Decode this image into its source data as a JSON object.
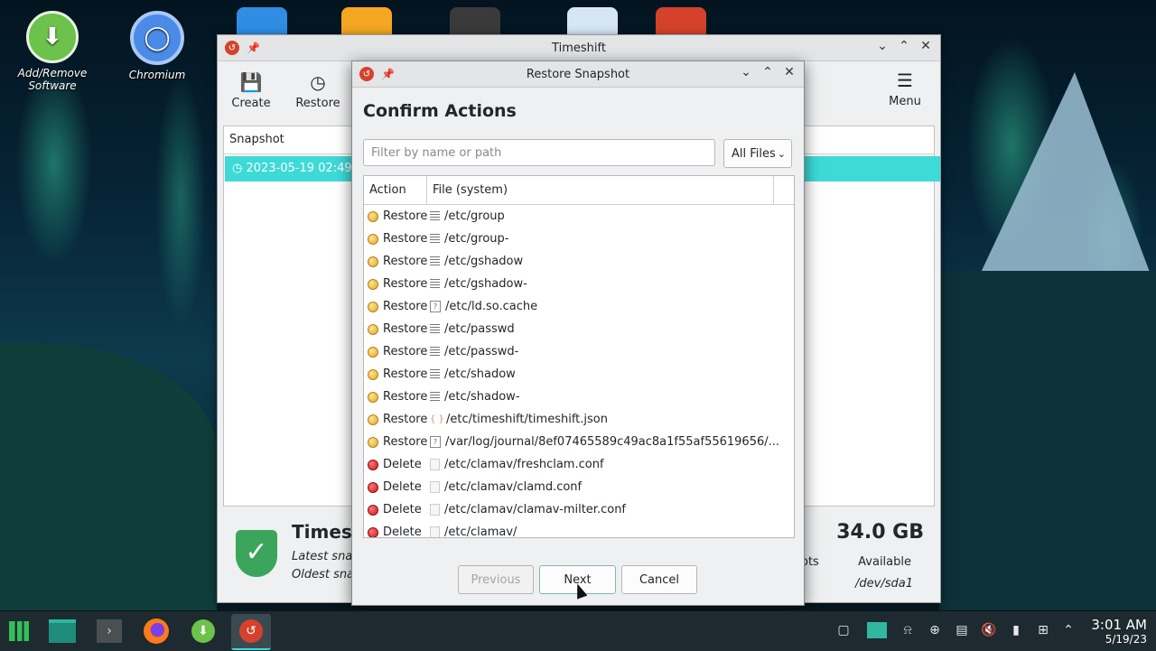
{
  "desktop": {
    "icons": [
      {
        "label": "Add/Remove\nSoftware",
        "label1": "Add/Remove",
        "label2": "Software",
        "icon": "software-center-icon"
      },
      {
        "label": "Chromium",
        "icon": "chromium-icon"
      }
    ]
  },
  "main_window": {
    "title": "Timeshift",
    "toolbar": {
      "create_label": "Create",
      "restore_label": "Restore",
      "menu_label": "Menu"
    },
    "list": {
      "column_snapshot": "Snapshot",
      "selected_row": "2023-05-19 02:49"
    },
    "status": {
      "title": "Timesh",
      "line1": "Latest snap",
      "line2": "Oldest snap",
      "snapshots_suffix": "ots",
      "size": "34.0 GB",
      "available_label": "Available",
      "device": "/dev/sda1"
    }
  },
  "dialog": {
    "title": "Restore Snapshot",
    "heading": "Confirm Actions",
    "filter_placeholder": "Filter by name or path",
    "filter_value": "",
    "filter_combo": "All Files",
    "columns": {
      "action": "Action",
      "file": "File (system)"
    },
    "rows": [
      {
        "action": "Restore",
        "kind": "restore",
        "icon": "text",
        "path": "/etc/group"
      },
      {
        "action": "Restore",
        "kind": "restore",
        "icon": "text",
        "path": "/etc/group-"
      },
      {
        "action": "Restore",
        "kind": "restore",
        "icon": "text",
        "path": "/etc/gshadow"
      },
      {
        "action": "Restore",
        "kind": "restore",
        "icon": "text",
        "path": "/etc/gshadow-"
      },
      {
        "action": "Restore",
        "kind": "restore",
        "icon": "binary",
        "path": "/etc/ld.so.cache"
      },
      {
        "action": "Restore",
        "kind": "restore",
        "icon": "text",
        "path": "/etc/passwd"
      },
      {
        "action": "Restore",
        "kind": "restore",
        "icon": "text",
        "path": "/etc/passwd-"
      },
      {
        "action": "Restore",
        "kind": "restore",
        "icon": "text",
        "path": "/etc/shadow"
      },
      {
        "action": "Restore",
        "kind": "restore",
        "icon": "text",
        "path": "/etc/shadow-"
      },
      {
        "action": "Restore",
        "kind": "restore",
        "icon": "json",
        "path": "/etc/timeshift/timeshift.json"
      },
      {
        "action": "Restore",
        "kind": "restore",
        "icon": "binary",
        "path": "/var/log/journal/8ef07465589c49ac8a1f55af55619656/..."
      },
      {
        "action": "Delete",
        "kind": "delete",
        "icon": "blank",
        "path": "/etc/clamav/freshclam.conf"
      },
      {
        "action": "Delete",
        "kind": "delete",
        "icon": "blank",
        "path": "/etc/clamav/clamd.conf"
      },
      {
        "action": "Delete",
        "kind": "delete",
        "icon": "blank",
        "path": "/etc/clamav/clamav-milter.conf"
      },
      {
        "action": "Delete",
        "kind": "delete",
        "icon": "blank",
        "path": "/etc/clamav/"
      }
    ],
    "buttons": {
      "previous": "Previous",
      "next": "Next",
      "cancel": "Cancel"
    }
  },
  "taskbar": {
    "apps": [
      "manjaro-menu-icon",
      "file-manager-icon",
      "terminal-icon",
      "firefox-icon",
      "software-center-icon",
      "timeshift-icon"
    ],
    "tray": [
      "window-icon",
      "display-icon",
      "notifications-icon",
      "updates-icon",
      "clipboard-icon",
      "volume-muted-icon",
      "usb-icon",
      "network-icon",
      "expand-tray-icon"
    ],
    "time": "3:01 AM",
    "date": "5/19/23"
  },
  "colors": {
    "selection": "#3ddad7",
    "restore_dot": "#e2a62a",
    "delete_dot": "#c81c1c",
    "shield": "#3ba55c",
    "app_red": "#d5422b"
  }
}
